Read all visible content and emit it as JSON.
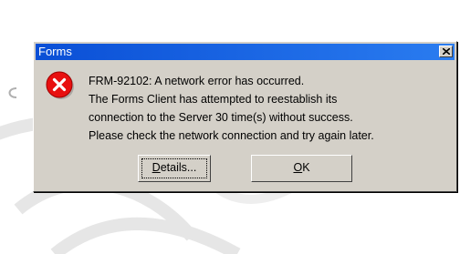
{
  "dialog": {
    "title": "Forms",
    "close_icon": "close-x-icon",
    "icon": "error-icon",
    "message_lines": [
      "FRM-92102: A network error has occurred.",
      "The Forms Client has attempted to reestablish its",
      "connection to the Server 30 time(s) without success.",
      "Please check the network connection and try again later."
    ],
    "buttons": {
      "details": {
        "mnemonic": "D",
        "rest": "etails..."
      },
      "ok": {
        "mnemonic": "O",
        "rest": "K"
      }
    }
  },
  "colors": {
    "titlebar": "#0a4fd6",
    "dialog_face": "#d4d0c8",
    "error_red": "#e81010"
  }
}
